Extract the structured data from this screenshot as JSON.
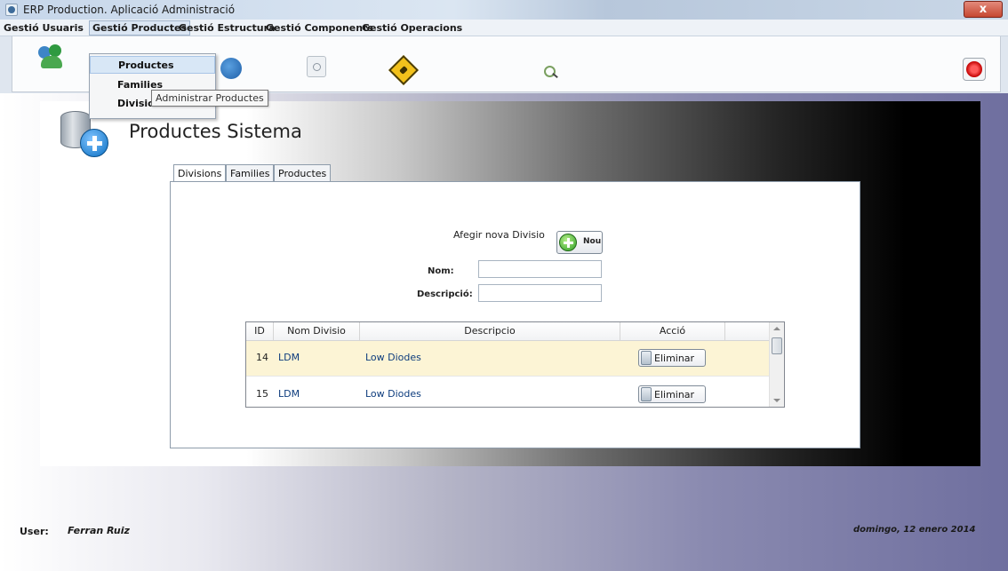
{
  "window": {
    "title": "ERP Production. Aplicació Administració",
    "close_label": "x"
  },
  "menubar": {
    "items": [
      "Gestió Usuaris",
      "Gestió Productes",
      "Gestió Estructura",
      "Gestió Components",
      "Gestió Operacions"
    ]
  },
  "toolbar": {
    "icons": [
      "users-icon",
      "globe-icon",
      "search-doc-icon",
      "warning-icon",
      "magnifier-icon",
      "power-icon"
    ]
  },
  "dropdown": {
    "items": [
      "Productes",
      "Families",
      "Divisions"
    ],
    "tooltip": "Administrar Productes"
  },
  "page": {
    "title": "Productes Sistema",
    "icon": "database-add-icon"
  },
  "tabs": [
    "Divisions",
    "Families",
    "Productes"
  ],
  "form": {
    "add_label": "Afegir nova Divisio",
    "add_button": "Nou",
    "nom_label": "Nom:",
    "nom_value": "",
    "descripcio_label": "Descripció:",
    "descripcio_value": ""
  },
  "grid": {
    "columns": [
      "ID",
      "Nom Divisio",
      "Descripcio",
      "Acció"
    ],
    "rows": [
      {
        "id": "14",
        "nom": "LDM",
        "descripcio": "Low Diodes",
        "action": "Eliminar"
      },
      {
        "id": "15",
        "nom": "LDM",
        "descripcio": "Low Diodes",
        "action": "Eliminar"
      }
    ]
  },
  "footer": {
    "user_label": "User:",
    "user_name": "Ferran Ruiz",
    "date": "domingo, 12 enero 2014"
  },
  "colors": {
    "selected_row": "#fcf4d5",
    "link_text": "#0d3c7d",
    "title_bar_close": "#c64731"
  }
}
